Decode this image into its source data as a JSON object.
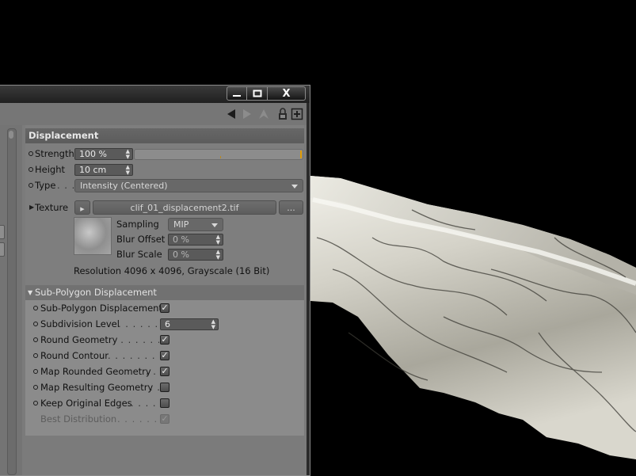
{
  "window": {
    "minimize_icon": "minimize-icon",
    "maximize_icon": "maximize-icon",
    "close_label": "X"
  },
  "toolbar": {
    "icons": [
      "back-arrow-icon",
      "forward-arrow-icon",
      "up-arrow-icon",
      "lock-icon",
      "new-panel-icon"
    ]
  },
  "displacement": {
    "header": "Displacement",
    "strength": {
      "label": "Strength",
      "value": "100 %",
      "slider_fraction": 1.0
    },
    "height": {
      "label": "Height",
      "value": "10 cm"
    },
    "type": {
      "label": "Type",
      "dots": ". . . .",
      "value": "Intensity (Centered)"
    },
    "texture": {
      "label": "Texture",
      "file": "clif_01_displacement2.tif",
      "browse_label": "...",
      "sampling": {
        "label": "Sampling",
        "value": "MIP"
      },
      "blur_offset": {
        "label": "Blur Offset",
        "value": "0 %"
      },
      "blur_scale": {
        "label": "Blur Scale",
        "value": "0 %"
      },
      "resolution": "Resolution 4096 x 4096, Grayscale (16 Bit)"
    }
  },
  "subpoly": {
    "header": "Sub-Polygon Displacement",
    "rows": [
      {
        "label": "Sub-Polygon Displacement",
        "dots": "",
        "checked": true,
        "enabled": true
      },
      {
        "label": "Subdivision Level",
        "dots": ". . . . . . . . .",
        "value": "6"
      },
      {
        "label": "Round Geometry",
        "dots": ". . . . . . . . . .",
        "checked": true,
        "enabled": true
      },
      {
        "label": "Round Contour",
        "dots": ". . . . . . . . . . .",
        "checked": true,
        "enabled": true
      },
      {
        "label": "Map Rounded Geometry",
        "dots": ". . .",
        "checked": true,
        "enabled": true
      },
      {
        "label": "Map Resulting Geometry",
        "dots": ". .",
        "checked": false,
        "enabled": true
      },
      {
        "label": "Keep Original Edges",
        "dots": ". . . . . .",
        "checked": false,
        "enabled": true
      },
      {
        "label": "Best Distribution",
        "dots": ". . . . . . . . . .",
        "checked": true,
        "enabled": false
      }
    ],
    "check_glyph": "✓"
  },
  "colors": {
    "panel_bg": "#7e7e7e",
    "header_bg": "#5f5f5f",
    "field_bg": "#5a5a5a",
    "accent_orange": "#e09a00",
    "viewport_bg": "#000000"
  }
}
